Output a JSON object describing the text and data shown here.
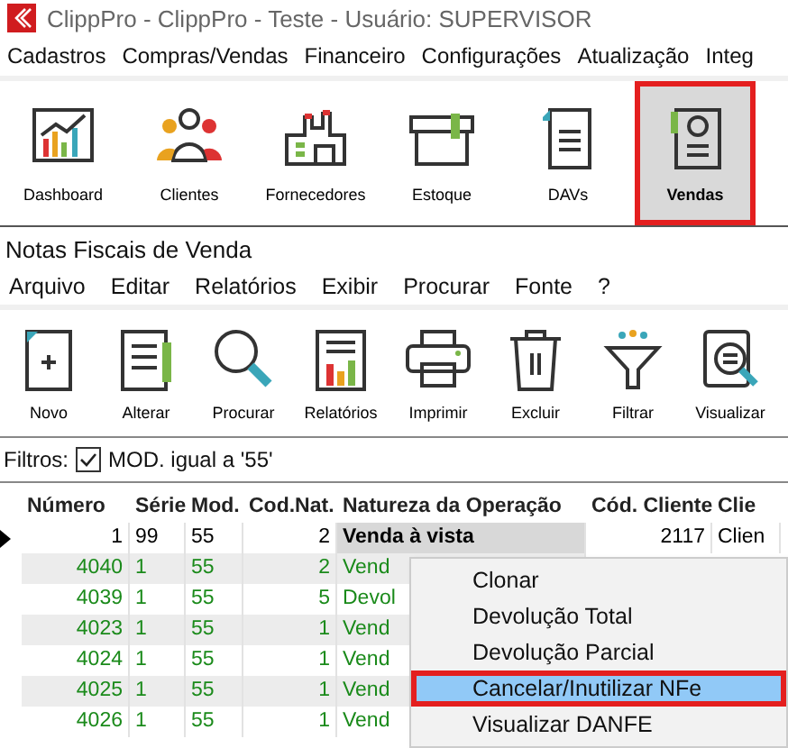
{
  "window": {
    "title": "ClippPro - ClippPro - Teste - Usuário: SUPERVISOR"
  },
  "main_menu": [
    "Cadastros",
    "Compras/Vendas",
    "Financeiro",
    "Configurações",
    "Atualização",
    "Integ"
  ],
  "main_toolbar": [
    {
      "label": "Dashboard",
      "selected": false
    },
    {
      "label": "Clientes",
      "selected": false
    },
    {
      "label": "Fornecedores",
      "selected": false
    },
    {
      "label": "Estoque",
      "selected": false
    },
    {
      "label": "DAVs",
      "selected": false
    },
    {
      "label": "Vendas",
      "selected": true
    }
  ],
  "form": {
    "title": "Notas Fiscais de Venda",
    "menu": [
      "Arquivo",
      "Editar",
      "Relatórios",
      "Exibir",
      "Procurar",
      "Fonte",
      "?"
    ],
    "toolbar": [
      "Novo",
      "Alterar",
      "Procurar",
      "Relatórios",
      "Imprimir",
      "Excluir",
      "Filtrar",
      "Visualizar"
    ],
    "filters": {
      "label": "Filtros:",
      "text": "MOD. igual a '55'",
      "checked": true
    },
    "table": {
      "columns": [
        "Número",
        "Série",
        "Mod.",
        "Cod.Nat.",
        "Natureza da Operação",
        "Cód. Cliente",
        "Clie"
      ],
      "rows": [
        {
          "current": true,
          "color": "#000000",
          "cells": [
            "1",
            "99",
            "55",
            "2",
            "Venda à vista",
            "2117",
            "Clien"
          ]
        },
        {
          "current": false,
          "color": "#1a8a1a",
          "cells": [
            "4040",
            "1",
            "55",
            "2",
            "Vend"
          ]
        },
        {
          "current": false,
          "color": "#1a8a1a",
          "cells": [
            "4039",
            "1",
            "55",
            "5",
            "Devol"
          ]
        },
        {
          "current": false,
          "color": "#1a8a1a",
          "cells": [
            "4023",
            "1",
            "55",
            "1",
            "Vend"
          ]
        },
        {
          "current": false,
          "color": "#1a8a1a",
          "cells": [
            "4024",
            "1",
            "55",
            "1",
            "Vend"
          ]
        },
        {
          "current": false,
          "color": "#1a8a1a",
          "cells": [
            "4025",
            "1",
            "55",
            "1",
            "Vend"
          ]
        },
        {
          "current": false,
          "color": "#1a8a1a",
          "cells": [
            "4026",
            "1",
            "55",
            "1",
            "Vend"
          ]
        }
      ]
    }
  },
  "context_menu": [
    {
      "label": "Clonar",
      "selected": false
    },
    {
      "label": "Devolução Total",
      "selected": false
    },
    {
      "label": "Devolução Parcial",
      "selected": false
    },
    {
      "label": "Cancelar/Inutilizar NFe",
      "selected": true
    },
    {
      "label": "Visualizar DANFE",
      "selected": false
    }
  ]
}
